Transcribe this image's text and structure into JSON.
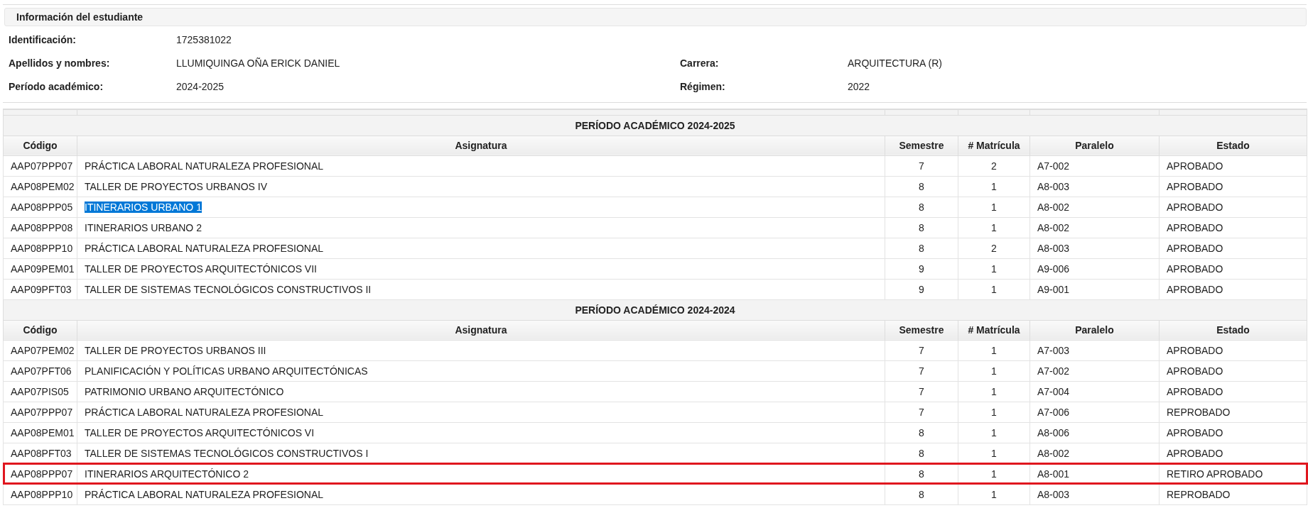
{
  "student_info": {
    "title": "Información del estudiante",
    "fields": [
      {
        "label": "Identificación:",
        "value": "1725381022"
      },
      {
        "label": "Apellidos y nombres:",
        "value": "LLUMIQUINGA OÑA ERICK DANIEL"
      },
      {
        "label": "Carrera:",
        "value": "ARQUITECTURA (R)"
      },
      {
        "label": "Período académico:",
        "value": "2024-2025"
      },
      {
        "label": "Régimen:",
        "value": "2022"
      }
    ]
  },
  "periods": [
    {
      "title": "PERÍODO ACADÉMICO 2024-2025",
      "columns": [
        "Código",
        "Asignatura",
        "Semestre",
        "# Matrícula",
        "Paralelo",
        "Estado"
      ],
      "rows": [
        {
          "cells": [
            "AAP07PPP07",
            "PRÁCTICA LABORAL NATURALEZA PROFESIONAL",
            "7",
            "2",
            "A7-002",
            "APROBADO"
          ],
          "text_selected": false,
          "highlighted": false
        },
        {
          "cells": [
            "AAP08PEM02",
            "TALLER DE PROYECTOS URBANOS IV",
            "8",
            "1",
            "A8-003",
            "APROBADO"
          ],
          "text_selected": false,
          "highlighted": false
        },
        {
          "cells": [
            "AAP08PPP05",
            "ITINERARIOS URBANO 1",
            "8",
            "1",
            "A8-002",
            "APROBADO"
          ],
          "text_selected": true,
          "highlighted": false
        },
        {
          "cells": [
            "AAP08PPP08",
            "ITINERARIOS URBANO 2",
            "8",
            "1",
            "A8-002",
            "APROBADO"
          ],
          "text_selected": false,
          "highlighted": false
        },
        {
          "cells": [
            "AAP08PPP10",
            "PRÁCTICA LABORAL NATURALEZA PROFESIONAL",
            "8",
            "2",
            "A8-003",
            "APROBADO"
          ],
          "text_selected": false,
          "highlighted": false
        },
        {
          "cells": [
            "AAP09PEM01",
            "TALLER DE PROYECTOS ARQUITECTÓNICOS VII",
            "9",
            "1",
            "A9-006",
            "APROBADO"
          ],
          "text_selected": false,
          "highlighted": false
        },
        {
          "cells": [
            "AAP09PFT03",
            "TALLER DE SISTEMAS TECNOLÓGICOS CONSTRUCTIVOS II",
            "9",
            "1",
            "A9-001",
            "APROBADO"
          ],
          "text_selected": false,
          "highlighted": false
        }
      ]
    },
    {
      "title": "PERÍODO ACADÉMICO 2024-2024",
      "columns": [
        "Código",
        "Asignatura",
        "Semestre",
        "# Matrícula",
        "Paralelo",
        "Estado"
      ],
      "rows": [
        {
          "cells": [
            "AAP07PEM02",
            "TALLER DE PROYECTOS URBANOS III",
            "7",
            "1",
            "A7-003",
            "APROBADO"
          ],
          "text_selected": false,
          "highlighted": false
        },
        {
          "cells": [
            "AAP07PFT06",
            "PLANIFICACIÓN Y POLÍTICAS URBANO ARQUITECTÓNICAS",
            "7",
            "1",
            "A7-002",
            "APROBADO"
          ],
          "text_selected": false,
          "highlighted": false
        },
        {
          "cells": [
            "AAP07PIS05",
            "PATRIMONIO URBANO ARQUITECTÓNICO",
            "7",
            "1",
            "A7-004",
            "APROBADO"
          ],
          "text_selected": false,
          "highlighted": false
        },
        {
          "cells": [
            "AAP07PPP07",
            "PRÁCTICA LABORAL NATURALEZA PROFESIONAL",
            "7",
            "1",
            "A7-006",
            "REPROBADO"
          ],
          "text_selected": false,
          "highlighted": false
        },
        {
          "cells": [
            "AAP08PEM01",
            "TALLER DE PROYECTOS ARQUITECTÓNICOS VI",
            "8",
            "1",
            "A8-006",
            "APROBADO"
          ],
          "text_selected": false,
          "highlighted": false
        },
        {
          "cells": [
            "AAP08PFT03",
            "TALLER DE SISTEMAS TECNOLÓGICOS CONSTRUCTIVOS I",
            "8",
            "1",
            "A8-002",
            "APROBADO"
          ],
          "text_selected": false,
          "highlighted": false
        },
        {
          "cells": [
            "AAP08PPP07",
            "ITINERARIOS ARQUITECTÓNICO 2",
            "8",
            "1",
            "A8-001",
            "RETIRO APROBADO"
          ],
          "text_selected": false,
          "highlighted": true
        },
        {
          "cells": [
            "AAP08PPP10",
            "PRÁCTICA LABORAL NATURALEZA PROFESIONAL",
            "8",
            "1",
            "A8-003",
            "REPROBADO"
          ],
          "text_selected": false,
          "highlighted": false
        }
      ]
    }
  ]
}
